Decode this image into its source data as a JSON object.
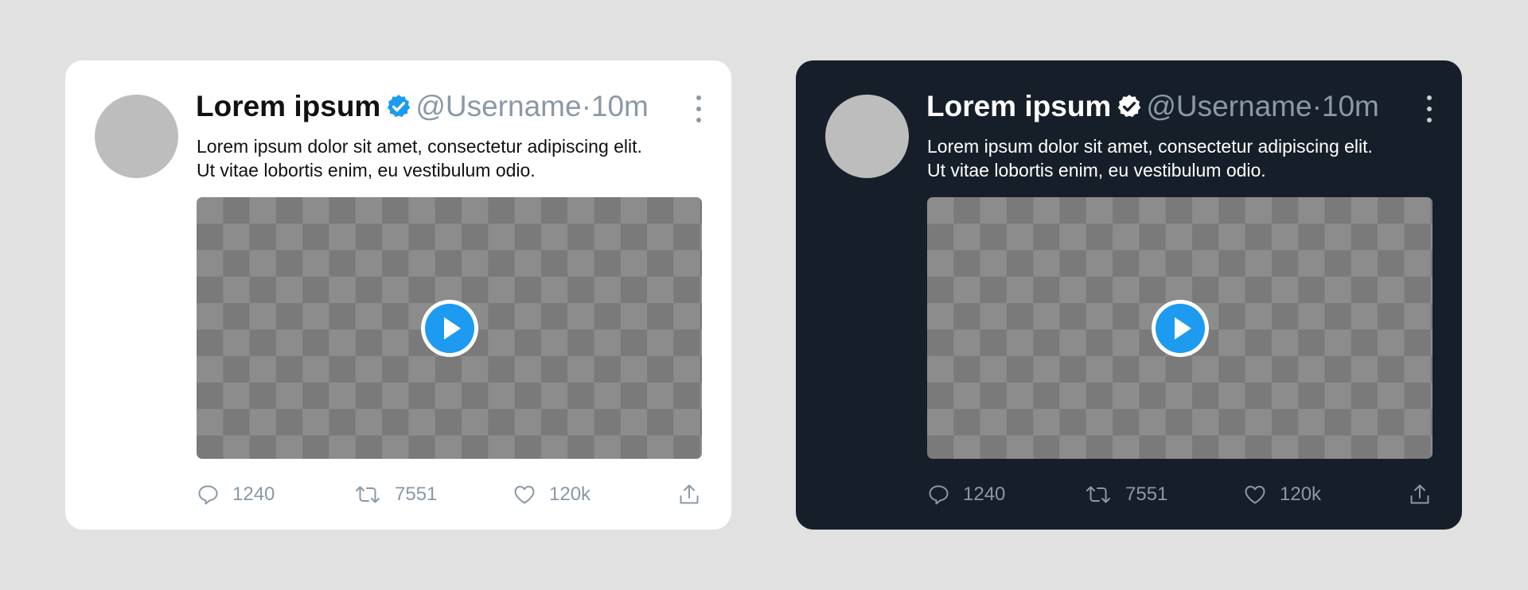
{
  "tweets": [
    {
      "theme": "light",
      "display_name": "Lorem ipsum",
      "handle": "@Username",
      "separator": "·",
      "time": "10m",
      "text_line1": "Lorem ipsum dolor sit amet, consectetur adipiscing elit.",
      "text_line2": "Ut vitae lobortis enim, eu vestibulum odio.",
      "replies": "1240",
      "retweets": "7551",
      "likes": "120k"
    },
    {
      "theme": "dark",
      "display_name": "Lorem ipsum",
      "handle": "@Username",
      "separator": "·",
      "time": "10m",
      "text_line1": "Lorem ipsum dolor sit amet, consectetur adipiscing elit.",
      "text_line2": "Ut vitae lobortis enim, eu vestibulum odio.",
      "replies": "1240",
      "retweets": "7551",
      "likes": "120k"
    }
  ],
  "icons": {
    "verified": "verified-badge-icon",
    "more": "more-options-icon",
    "play": "play-icon",
    "reply": "reply-icon",
    "retweet": "retweet-icon",
    "like": "heart-icon",
    "share": "share-icon"
  },
  "colors": {
    "accent": "#1d9bf0",
    "muted": "#8b98a5",
    "dark_card": "#161f29",
    "light_card": "#ffffff",
    "page_background": "#e1e1e1",
    "avatar_placeholder": "#bdbdbd"
  }
}
